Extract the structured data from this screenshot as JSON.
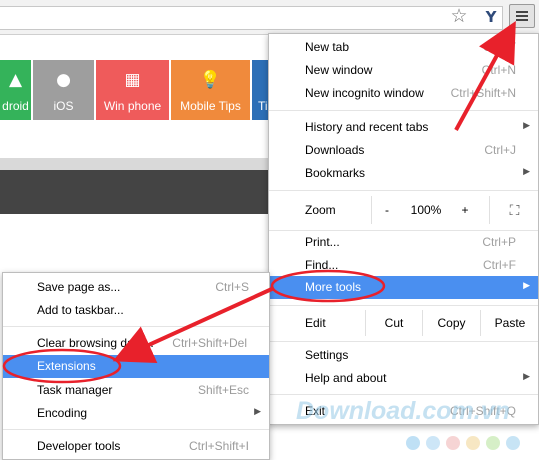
{
  "tiles": [
    {
      "label": "droid",
      "color": "#34b35a",
      "icon": "android-icon"
    },
    {
      "label": "iOS",
      "color": "#9e9e9e",
      "icon": "apple-icon"
    },
    {
      "label": "Win phone",
      "color": "#ef5b5b",
      "icon": "windows-icon"
    },
    {
      "label": "Mobile Tips",
      "color": "#f08a3c",
      "icon": "lightbulb-icon"
    },
    {
      "label": "Ti",
      "color": "#2c6fb7",
      "icon": ""
    }
  ],
  "menu": {
    "new_tab": {
      "label": "New tab",
      "shortcut": "Ctrl+T"
    },
    "new_window": {
      "label": "New window",
      "shortcut": "Ctrl+N"
    },
    "new_incognito": {
      "label": "New incognito window",
      "shortcut": "Ctrl+Shift+N"
    },
    "history": {
      "label": "History and recent tabs"
    },
    "downloads": {
      "label": "Downloads",
      "shortcut": "Ctrl+J"
    },
    "bookmarks": {
      "label": "Bookmarks"
    },
    "zoom": {
      "label": "Zoom",
      "minus": "-",
      "value": "100%",
      "plus": "+"
    },
    "print": {
      "label": "Print...",
      "shortcut": "Ctrl+P"
    },
    "find": {
      "label": "Find...",
      "shortcut": "Ctrl+F"
    },
    "more_tools": {
      "label": "More tools"
    },
    "edit": {
      "label": "Edit",
      "cut": "Cut",
      "copy": "Copy",
      "paste": "Paste"
    },
    "settings": {
      "label": "Settings"
    },
    "help": {
      "label": "Help and about"
    },
    "exit": {
      "label": "Exit",
      "shortcut": "Ctrl+Shift+Q"
    }
  },
  "submenu": {
    "save_page": {
      "label": "Save page as...",
      "shortcut": "Ctrl+S"
    },
    "add_taskbar": {
      "label": "Add to taskbar..."
    },
    "clear_browsing": {
      "label": "Clear browsing data...",
      "shortcut": "Ctrl+Shift+Del"
    },
    "extensions": {
      "label": "Extensions"
    },
    "task_manager": {
      "label": "Task manager",
      "shortcut": "Shift+Esc"
    },
    "encoding": {
      "label": "Encoding"
    },
    "developer_tools": {
      "label": "Developer tools",
      "shortcut": "Ctrl+Shift+I"
    }
  },
  "watermark": "Download.com.vn",
  "colors": {
    "highlight": "#4a8ff0",
    "annotation_red": "#e8212b"
  }
}
